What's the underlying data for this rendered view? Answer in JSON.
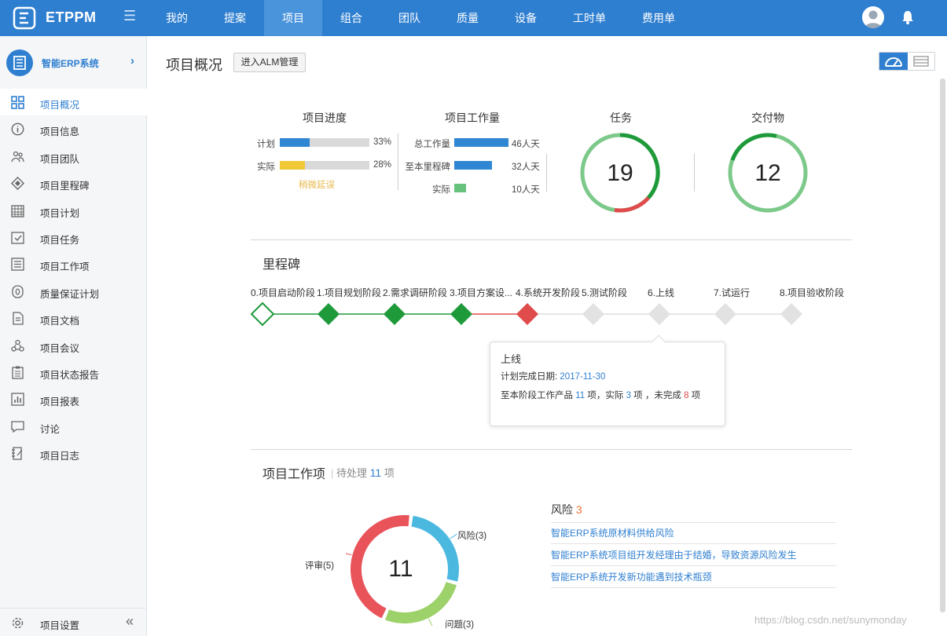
{
  "app": {
    "brand": "ETPPM"
  },
  "nav": {
    "items": [
      "我的",
      "提案",
      "项目",
      "组合",
      "团队",
      "质量",
      "设备",
      "工时单",
      "费用单"
    ],
    "active_index": 2
  },
  "sidebar": {
    "system_label": "智能ERP系统",
    "items": [
      {
        "label": "项目概况",
        "icon": "grid-icon"
      },
      {
        "label": "项目信息",
        "icon": "info-icon"
      },
      {
        "label": "项目团队",
        "icon": "team-icon"
      },
      {
        "label": "项目里程碑",
        "icon": "milestone-icon"
      },
      {
        "label": "项目计划",
        "icon": "calendar-icon"
      },
      {
        "label": "项目任务",
        "icon": "task-icon"
      },
      {
        "label": "项目工作项",
        "icon": "list-icon"
      },
      {
        "label": "质量保证计划",
        "icon": "quality-icon"
      },
      {
        "label": "项目文档",
        "icon": "document-icon"
      },
      {
        "label": "项目会议",
        "icon": "meeting-icon"
      },
      {
        "label": "项目状态报告",
        "icon": "report-icon"
      },
      {
        "label": "项目报表",
        "icon": "chart-icon"
      },
      {
        "label": "讨论",
        "icon": "comment-icon"
      },
      {
        "label": "项目日志",
        "icon": "log-icon"
      }
    ],
    "active_index": 0,
    "settings_label": "项目设置"
  },
  "header": {
    "title": "项目概况",
    "alm_button": "进入ALM管理"
  },
  "progress": {
    "title": "项目进度",
    "plan_label": "计划",
    "plan_value": "33%",
    "plan_fraction": 0.33,
    "actual_label": "实际",
    "actual_value": "28%",
    "actual_fraction": 0.28,
    "status": "稍微延误"
  },
  "workload": {
    "title": "项目工作量",
    "rows": [
      {
        "label": "总工作量",
        "value": "46人天",
        "days": 46
      },
      {
        "label": "至本里程碑",
        "value": "32人天",
        "days": 32
      },
      {
        "label": "实际",
        "value": "10人天",
        "days": 10
      }
    ]
  },
  "tasks": {
    "title": "任务",
    "count": "19"
  },
  "deliverables": {
    "title": "交付物",
    "count": "12"
  },
  "milestones": {
    "title": "里程碑",
    "items": [
      {
        "label": "0.项目启动阶段",
        "state": "open"
      },
      {
        "label": "1.项目规划阶段",
        "state": "done"
      },
      {
        "label": "2.需求调研阶段",
        "state": "done"
      },
      {
        "label": "3.项目方案设...",
        "state": "done"
      },
      {
        "label": "4.系统开发阶段",
        "state": "late"
      },
      {
        "label": "5.测试阶段",
        "state": "future"
      },
      {
        "label": "6.上线",
        "state": "future"
      },
      {
        "label": "7.试运行",
        "state": "future"
      },
      {
        "label": "8.项目验收阶段",
        "state": "future"
      }
    ],
    "tooltip": {
      "title": "上线",
      "date_label": "计划完成日期:",
      "date": "2017-11-30",
      "products_prefix": "至本阶段工作产品",
      "products_total": "11",
      "products_mid": "项，实际",
      "products_actual": "3",
      "products_mid2": "项 ，未完成",
      "products_open": "8",
      "products_suffix": "项"
    }
  },
  "work_items": {
    "title": "项目工作项",
    "pending_label": "待处理",
    "pending_count": "11",
    "pending_unit": "项",
    "total": "11",
    "chart_data": {
      "type": "pie",
      "categories": [
        "风险",
        "问题",
        "评审"
      ],
      "values": [
        3,
        3,
        5
      ],
      "labels": [
        "风险(3)",
        "问题(3)",
        "评审(5)"
      ],
      "colors": [
        "#4bb8e0",
        "#9dd16a",
        "#e8545a"
      ]
    }
  },
  "risks": {
    "title": "风险",
    "count": "3",
    "items": [
      "智能ERP系统原材料供给风险",
      "智能ERP系统项目组开发经理由于结婚，导致资源风险发生",
      "智能ERP系统开发新功能遇到技术瓶颈"
    ]
  },
  "watermark": "https://blog.csdn.net/sunymonday",
  "colors": {
    "primary": "#2f7fd0",
    "done": "#1e9a3a",
    "late": "#e04b4b",
    "future": "#e0e0e0"
  }
}
